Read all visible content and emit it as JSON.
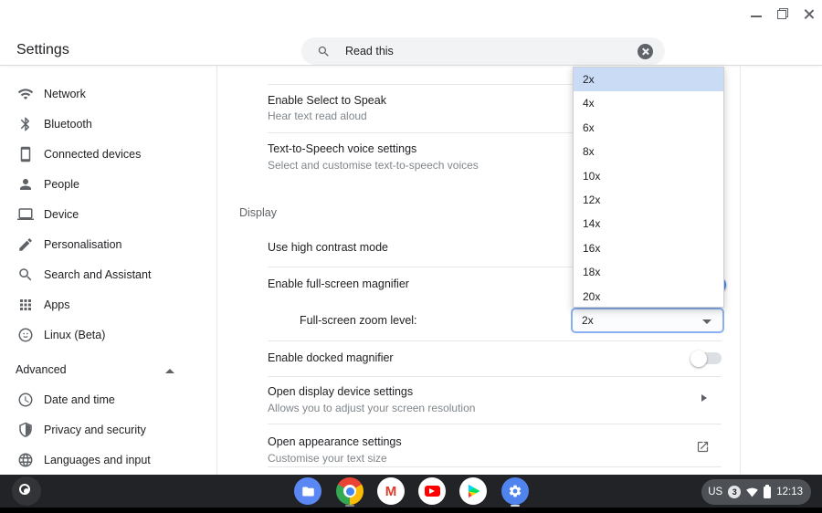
{
  "window": {
    "app_title": "Settings"
  },
  "header": {
    "search_value": "Read this",
    "search_icon": "magnifier-icon",
    "clear_icon": "clear-circle-icon"
  },
  "sidebar": {
    "items": [
      {
        "label": "Network",
        "icon": "wifi-icon"
      },
      {
        "label": "Bluetooth",
        "icon": "bluetooth-icon"
      },
      {
        "label": "Connected devices",
        "icon": "smartphone-icon"
      },
      {
        "label": "People",
        "icon": "person-icon"
      },
      {
        "label": "Device",
        "icon": "laptop-icon"
      },
      {
        "label": "Personalisation",
        "icon": "pen-icon"
      },
      {
        "label": "Search and Assistant",
        "icon": "search-icon"
      },
      {
        "label": "Apps",
        "icon": "apps-grid-icon"
      },
      {
        "label": "Linux (Beta)",
        "icon": "penguin-icon"
      }
    ],
    "advanced_label": "Advanced",
    "advanced_items": [
      {
        "label": "Date and time",
        "icon": "clock-icon"
      },
      {
        "label": "Privacy and security",
        "icon": "shield-icon"
      },
      {
        "label": "Languages and input",
        "icon": "globe-icon"
      }
    ]
  },
  "content": {
    "select_to_speak": {
      "title": "Enable Select to Speak",
      "subtitle": "Hear text read aloud"
    },
    "tts": {
      "title": "Text-to-Speech voice settings",
      "subtitle": "Select and customise text-to-speech voices"
    },
    "section_display": "Display",
    "high_contrast": {
      "title": "Use high contrast mode"
    },
    "fullscreen_magnifier": {
      "title": "Enable full-screen magnifier",
      "toggle_state": "on"
    },
    "zoom_level": {
      "label": "Full-screen zoom level:",
      "value": "2x"
    },
    "docked_magnifier": {
      "title": "Enable docked magnifier",
      "toggle_state": "off"
    },
    "display_device": {
      "title": "Open display device settings",
      "subtitle": "Allows you to adjust your screen resolution"
    },
    "appearance": {
      "title": "Open appearance settings",
      "subtitle": "Customise your text size"
    }
  },
  "dropdown": {
    "options": [
      "2x",
      "4x",
      "6x",
      "8x",
      "10x",
      "12x",
      "14x",
      "16x",
      "18x",
      "20x"
    ],
    "selected": "2x"
  },
  "shelf": {
    "apps": [
      "files",
      "chrome",
      "gmail",
      "youtube",
      "play-store",
      "settings"
    ],
    "gmail_letter": "M",
    "tray": {
      "keyboard_layout": "US",
      "notification_count": "3",
      "time": "12:13"
    }
  },
  "colors": {
    "accent": "#4285f4",
    "dropdown_highlight": "#cadcf5",
    "shelf_bg": "#212327",
    "search_pill": "#f1f3f4"
  }
}
